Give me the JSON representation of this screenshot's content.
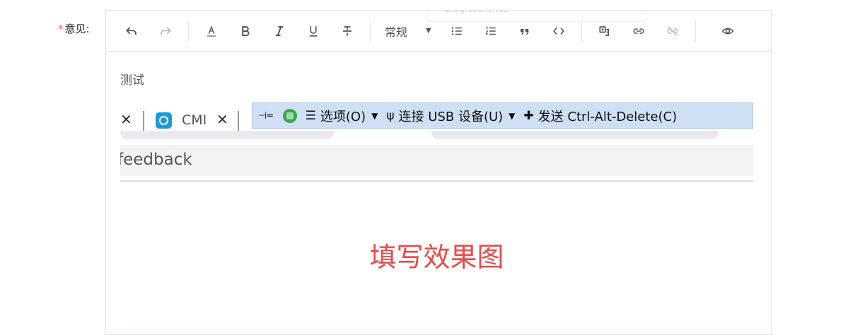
{
  "field": {
    "required_mark": "*",
    "label": "意见:"
  },
  "toolbar": {
    "heading_value": "常规",
    "ghost_tooltip": "blog.csdn.net",
    "buttons": [
      "undo-icon",
      "redo-icon",
      "font-color-icon",
      "bold-icon",
      "italic-icon",
      "underline-icon",
      "strikethrough-icon",
      "bullet-list-icon",
      "numbered-list-icon",
      "blockquote-icon",
      "code-icon",
      "image-icon",
      "link-icon",
      "unlink-icon",
      "preview-icon"
    ]
  },
  "content": {
    "typed_text": "测试",
    "screenshot": {
      "tab_title": "CMI",
      "close_glyph": "✕",
      "vm_bar": {
        "options_label": "选项(O)",
        "usb_label": "连接 USB 设备(U)",
        "send_label": "发送 Ctrl-Alt-Delete(C)"
      },
      "address_text": "feedback",
      "caption": "填写效果图"
    }
  },
  "colors": {
    "required": "#f56c6c",
    "caption": "#e84a4a",
    "vm_bar_bg": "#cfe0f5",
    "address_bg": "#f1f3f4"
  }
}
